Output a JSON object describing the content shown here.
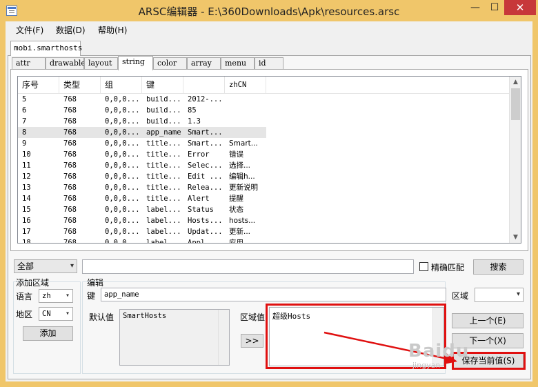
{
  "window": {
    "title": "ARSC编辑器 - E:\\360Downloads\\Apk\\resources.arsc",
    "minimize": "—",
    "maximize": "☐",
    "close": "✕"
  },
  "menu": [
    "文件(F)",
    "数据(D)",
    "帮助(H)"
  ],
  "outer_tab": "mobi.smarthosts",
  "inner_tabs": [
    "attr",
    "drawable",
    "layout",
    "string",
    "color",
    "array",
    "menu",
    "id"
  ],
  "active_inner_tab": "string",
  "table": {
    "columns": [
      "序号",
      "类型",
      "组",
      "键",
      "",
      "zhCN"
    ],
    "rows": [
      [
        "5",
        "768",
        "0,0,0...",
        "build...",
        "2012-...",
        ""
      ],
      [
        "6",
        "768",
        "0,0,0...",
        "build...",
        "85",
        ""
      ],
      [
        "7",
        "768",
        "0,0,0...",
        "build...",
        "1.3",
        ""
      ],
      [
        "8",
        "768",
        "0,0,0...",
        "app_name",
        "Smart...",
        ""
      ],
      [
        "9",
        "768",
        "0,0,0...",
        "title...",
        "Smart...",
        "Smart..."
      ],
      [
        "10",
        "768",
        "0,0,0...",
        "title...",
        "Error",
        "错误"
      ],
      [
        "11",
        "768",
        "0,0,0...",
        "title...",
        "Selec...",
        "选择..."
      ],
      [
        "12",
        "768",
        "0,0,0...",
        "title...",
        "Edit ...",
        "编辑h..."
      ],
      [
        "13",
        "768",
        "0,0,0...",
        "title...",
        "Relea...",
        "更新说明"
      ],
      [
        "14",
        "768",
        "0,0,0...",
        "title...",
        "Alert",
        "提醒"
      ],
      [
        "15",
        "768",
        "0,0,0...",
        "label...",
        "Status",
        "状态"
      ],
      [
        "16",
        "768",
        "0,0,0...",
        "label...",
        "Hosts...",
        "hosts..."
      ],
      [
        "17",
        "768",
        "0,0,0...",
        "label...",
        "Updat...",
        "更新..."
      ],
      [
        "18",
        "768",
        "0,0,0...",
        "label...",
        "Appl...",
        "应用..."
      ]
    ],
    "selected_row": 3,
    "scroll_up": "▲",
    "scroll_down": "▼"
  },
  "filter": {
    "scope": "全部",
    "search_value": "",
    "exact_match_label": "精确匹配",
    "search_button": "搜索",
    "dropdown_glyph": "▾"
  },
  "add_region": {
    "title": "添加区域",
    "language_label": "语言",
    "language": "zh",
    "region_label": "地区",
    "region": "CN",
    "add_button": "添加"
  },
  "edit": {
    "title": "编辑",
    "key_label": "键",
    "key_value": "app_name",
    "domain_label": "区域",
    "domain_value": "",
    "default_label": "默认值",
    "default_value": "SmartHosts",
    "domain_value_label": "区域值",
    "domain_text": "超级Hosts",
    "copy_button": ">>",
    "prev_button": "上一个(E)",
    "next_button": "下一个(X)",
    "save_button": "保存当前值(S)"
  },
  "watermark": {
    "brand": "Baidu",
    "sub": "jingyan"
  },
  "accent": {
    "titlebar": "#f0c66a",
    "close": "#c7383a",
    "highlight": "#e01010"
  }
}
